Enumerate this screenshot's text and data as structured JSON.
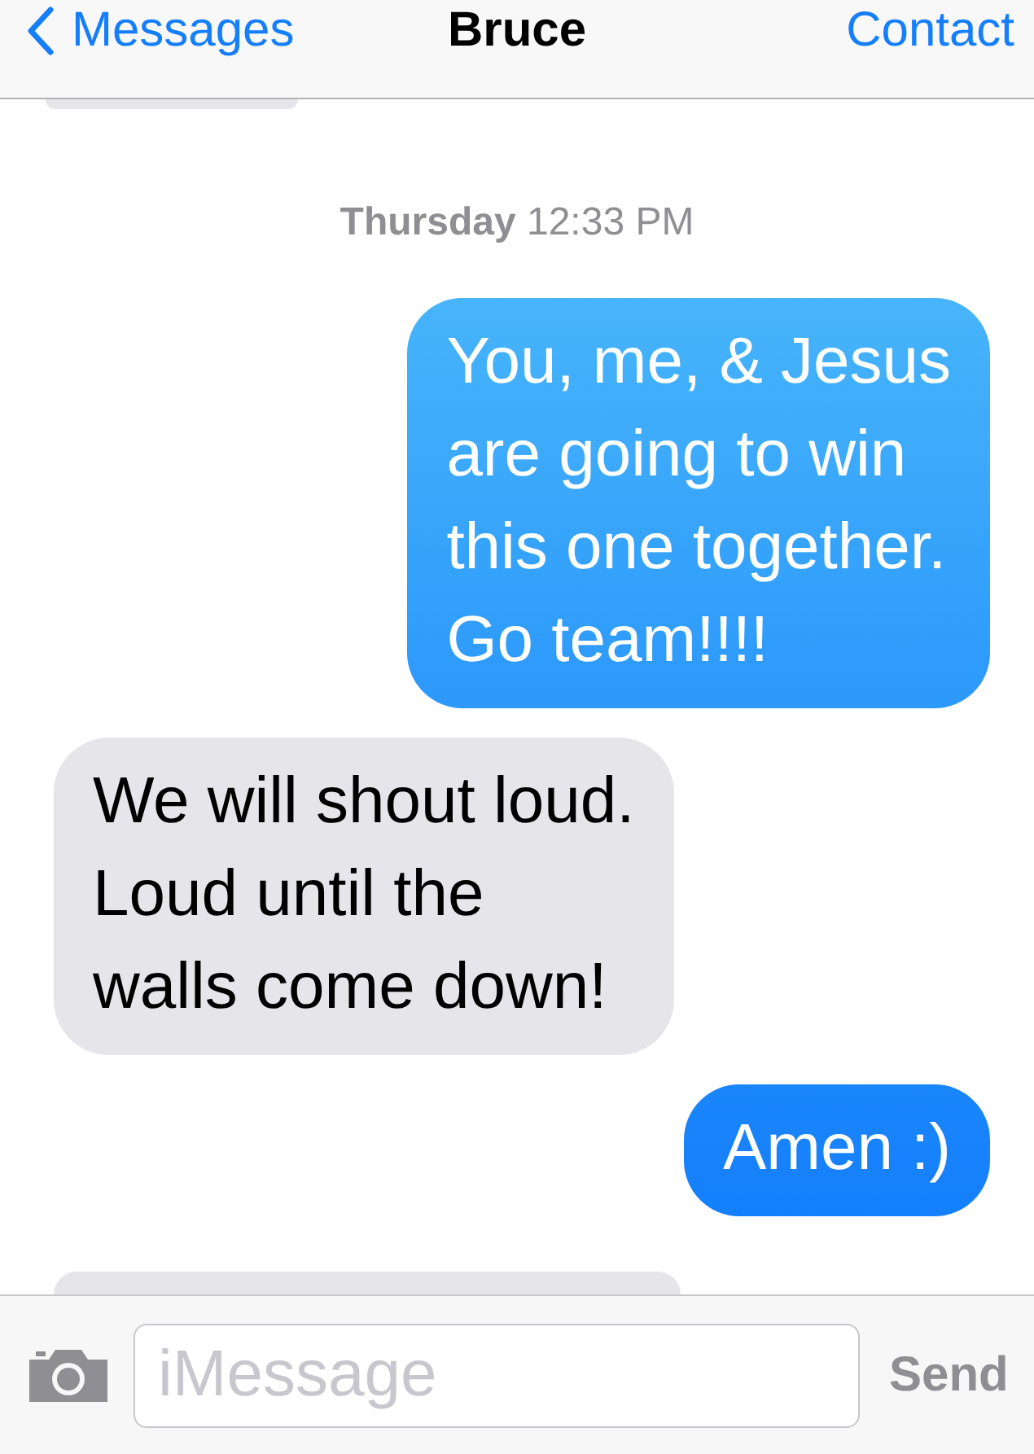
{
  "nav": {
    "back": "Messages",
    "title": "Bruce",
    "action": "Contact"
  },
  "messages": [
    {
      "kind": "cut-top"
    },
    {
      "kind": "timestamp",
      "day": "Thursday",
      "time": "12:33 PM"
    },
    {
      "kind": "outgoing",
      "text": "You, me, & Jesus\nare going to win\nthis one together.\nGo team!!!!"
    },
    {
      "kind": "incoming",
      "text": "We will shout loud.\nLoud until the\nwalls come down!"
    },
    {
      "kind": "outgoing",
      "text": "Amen :)"
    },
    {
      "kind": "cut-bottom"
    }
  ],
  "composer": {
    "placeholder": "iMessage",
    "send": "Send"
  }
}
